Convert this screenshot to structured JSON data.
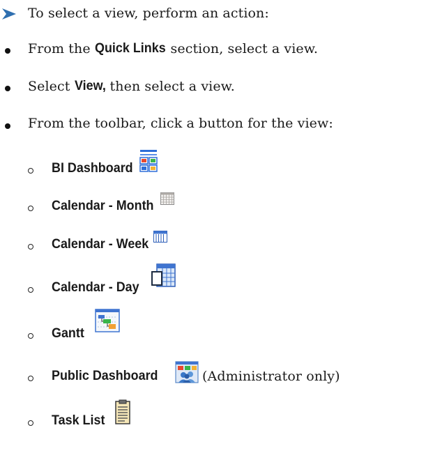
{
  "intro": {
    "text": "To select a view, perform an action:"
  },
  "actions": [
    {
      "prefix": "From the ",
      "bold": "Quick Links",
      "suffix": " section, select a view."
    },
    {
      "prefix": "Select ",
      "bold": "View,",
      "suffix": " then select a view."
    },
    {
      "prefix": "From the toolbar, click a button for the view:",
      "bold": "",
      "suffix": ""
    }
  ],
  "views": [
    {
      "label": "BI Dashboard",
      "icon": "bi-dashboard-icon",
      "note": ""
    },
    {
      "label": "Calendar - Month",
      "icon": "calendar-month-icon",
      "note": ""
    },
    {
      "label": "Calendar - Week",
      "icon": "calendar-week-icon",
      "note": ""
    },
    {
      "label": "Calendar - Day",
      "icon": "calendar-day-icon",
      "note": ""
    },
    {
      "label": "Gantt",
      "icon": "gantt-icon",
      "note": ""
    },
    {
      "label": "Public Dashboard",
      "icon": "public-dashboard-icon",
      "note": "(Administrator only)"
    },
    {
      "label": "Task List",
      "icon": "task-list-icon",
      "note": ""
    }
  ],
  "colors": {
    "arrow": "#2f6fb0",
    "text": "#1a1a1a"
  }
}
